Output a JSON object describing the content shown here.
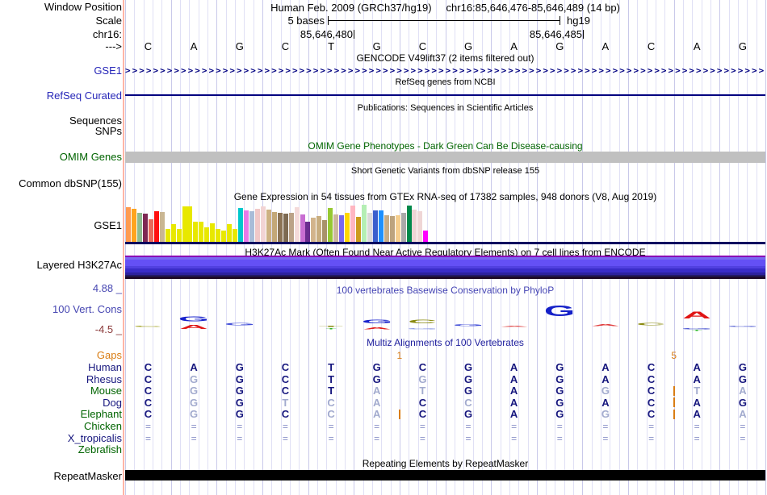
{
  "header": {
    "assembly": "Human Feb. 2009 (GRCh37/hg19)",
    "position": "chr16:85,646,476-85,646,489 (14 bp)"
  },
  "scale": {
    "value": "5 bases",
    "genome": "hg19"
  },
  "coords": {
    "left": "85,646,480",
    "right": "85,646,485"
  },
  "ruler_bases": [
    "C",
    "A",
    "G",
    "C",
    "T",
    "G",
    "C",
    "G",
    "A",
    "G",
    "A",
    "C",
    "A",
    "G"
  ],
  "labels": {
    "window_position": "Window Position",
    "scale": "Scale",
    "chrom": "chr16:",
    "direction": "--->",
    "gse1_gencode": "GSE1",
    "refseq_curated": "RefSeq Curated",
    "sequences": "Sequences",
    "snps": "SNPs",
    "omim_genes": "OMIM Genes",
    "common_dbsnp": "Common dbSNP(155)",
    "gse1_gtex": "GSE1",
    "layered_h3k27ac": "Layered H3K27Ac",
    "cons_max": "4.88 _",
    "vert_cons": "100 Vert. Cons",
    "cons_min": "-4.5 _",
    "gaps": "Gaps",
    "repeatmasker": "RepeatMasker"
  },
  "titles": {
    "gencode": "GENCODE V49lift37 (2 items filtered out)",
    "refseq": "RefSeq genes from NCBI",
    "publications": "Publications: Sequences in Scientific Articles",
    "omim": "OMIM Gene Phenotypes - Dark Green Can Be Disease-causing",
    "dbsnp": "Short Genetic Variants from dbSNP release 155",
    "gtex": "Gene Expression in 54 tissues from GTEx RNA-seq of 17382 samples, 948 donors (V8, Aug 2019)",
    "h3k27ac": "H3K27Ac Mark (Often Found Near Active Regulatory Elements) on 7 cell lines from ENCODE",
    "phylop": "100 vertebrates Basewise Conservation by PhyloP",
    "multiz": "Multiz Alignments of 100 Vertebrates",
    "repeatmasker": "Repeating Elements by RepeatMasker"
  },
  "colors": {
    "label_blue": "#2626b8",
    "dark_green": "#006400",
    "orange": "#d97d14",
    "navy_letter": "#16167e",
    "light_letter": "#a2aace",
    "eq_letter": "#8890c8",
    "grid_light": "#e0e0f5",
    "grid_dark": "#c9c9ea",
    "pink_edge": "#ffb4a6",
    "track_navy": "#000080",
    "baseline_navy": "#000060",
    "omim_gray": "#c0c0c0",
    "repeat_black": "#000000",
    "phylop_title": "#4646b4",
    "multiz_title": "#20209e",
    "cons_label": "#4747b2",
    "cons_min_red": "#8b3a3a"
  },
  "gtex_track": {
    "type": "bar",
    "note": "54 tissue expression bars, heights in px below 45px max, baseline navy",
    "bars": [
      [
        "#FF9A50",
        43
      ],
      [
        "#FFA41E",
        41
      ],
      [
        "#8FBC8F",
        36
      ],
      [
        "#7E2954",
        35
      ],
      [
        "#E8695A",
        28
      ],
      [
        "#FF1010",
        38
      ],
      [
        "#C9B693",
        37
      ],
      [
        "#E8E800",
        16
      ],
      [
        "#E8E800",
        22
      ],
      [
        "#E8E800",
        16
      ],
      [
        "#E8E800",
        44
      ],
      [
        "#E8E800",
        44
      ],
      [
        "#E8E800",
        25
      ],
      [
        "#E8E800",
        25
      ],
      [
        "#E8E800",
        18
      ],
      [
        "#E8E800",
        23
      ],
      [
        "#E8E800",
        16
      ],
      [
        "#E8E800",
        14
      ],
      [
        "#E8E800",
        22
      ],
      [
        "#E8E800",
        16
      ],
      [
        "#00C8CC",
        42
      ],
      [
        "#E87AE8",
        39
      ],
      [
        "#A8BCD8",
        38
      ],
      [
        "#F0C8C8",
        41
      ],
      [
        "#F2D4D4",
        44
      ],
      [
        "#CDB183",
        40
      ],
      [
        "#C4A878",
        37
      ],
      [
        "#8B7355",
        36
      ],
      [
        "#7D6A52",
        35
      ],
      [
        "#BBA288",
        36
      ],
      [
        "#F4DADA",
        43
      ],
      [
        "#C86ED2",
        34
      ],
      [
        "#6A2D8F",
        25
      ],
      [
        "#D2B48C",
        30
      ],
      [
        "#C8AD7F",
        32
      ],
      [
        "#A9926B",
        27
      ],
      [
        "#96C832",
        42
      ],
      [
        "#CDB79E",
        34
      ],
      [
        "#7A67EE",
        33
      ],
      [
        "#FFD700",
        36
      ],
      [
        "#FFB6C1",
        45
      ],
      [
        "#CD9B1D",
        31
      ],
      [
        "#B4EEB4",
        46
      ],
      [
        "#D9D9D9",
        36
      ],
      [
        "#3A5FCD",
        39
      ],
      [
        "#1E90FF",
        39
      ],
      [
        "#C8AD87",
        33
      ],
      [
        "#BCA37E",
        32
      ],
      [
        "#F5CE8E",
        33
      ],
      [
        "#A9A9A9",
        36
      ],
      [
        "#00894B",
        45
      ],
      [
        "#EED5D5",
        40
      ],
      [
        "#EFD6D6",
        38
      ],
      [
        "#FF00FF",
        14
      ]
    ]
  },
  "h3k27ac_bands": [
    [
      "#8A00B4",
      2
    ],
    [
      "#7B68F0",
      3
    ],
    [
      "#6450F5",
      8
    ],
    [
      "#5140E0",
      3
    ],
    [
      "#3A2CC8",
      5
    ],
    [
      "#2D21A0",
      3
    ],
    [
      "#231A66",
      2
    ],
    [
      "#1E0A28",
      3
    ]
  ],
  "conservation": {
    "positions": [
      {
        "up": [
          [
            "C",
            "#96960a",
            2
          ]
        ],
        "down": []
      },
      {
        "up": [
          [
            "G",
            "#1822cc",
            8
          ]
        ],
        "down": [
          [
            "A",
            "#e01818",
            7
          ]
        ]
      },
      {
        "up": [
          [
            "G",
            "#4450d8",
            4
          ]
        ],
        "down": []
      },
      {
        "up": [],
        "down": []
      },
      {
        "up": [
          [
            "T",
            "#8a8a10",
            2
          ]
        ],
        "down": [
          [
            "T",
            "#28b428",
            2,
            1
          ]
        ]
      },
      {
        "up": [
          [
            "G",
            "#1822cc",
            6
          ]
        ],
        "down": [
          [
            "A",
            "#e02020",
            3
          ]
        ]
      },
      {
        "up": [
          [
            "C",
            "#8a8a10",
            6
          ]
        ],
        "down": [
          [
            "G",
            "#8090e0",
            2
          ]
        ]
      },
      {
        "up": [
          [
            "G",
            "#4450d8",
            3
          ]
        ],
        "down": []
      },
      {
        "up": [
          [
            "A",
            "#e05050",
            2
          ]
        ],
        "down": []
      },
      {
        "up": [
          [
            "G",
            "#1420c8",
            17
          ]
        ],
        "down": []
      },
      {
        "up": [
          [
            "A",
            "#e04040",
            3
          ]
        ],
        "down": []
      },
      {
        "up": [
          [
            "C",
            "#8a8a10",
            4
          ]
        ],
        "down": []
      },
      {
        "up": [
          [
            "A",
            "#e01414",
            11
          ]
        ],
        "down": [
          [
            "G",
            "#2a36c8",
            2
          ],
          [
            "T",
            "#28b428",
            2,
            1
          ]
        ]
      },
      {
        "up": [
          [
            "G",
            "#4a56d0",
            2
          ]
        ],
        "down": []
      }
    ]
  },
  "multiz": {
    "gap_markers": [
      {
        "label": "1",
        "boundary": 6
      },
      {
        "label": "5",
        "boundary": 12
      }
    ],
    "insertions": [
      {
        "boundary": 6,
        "rows": [
          4
        ]
      },
      {
        "boundary": 12,
        "rows": [
          2,
          3,
          4
        ]
      }
    ],
    "rows": [
      {
        "label": "Human",
        "label_color": "#16167e",
        "seq": "CAGCTGCGAGACAG",
        "light": []
      },
      {
        "label": "Rhesus",
        "label_color": "#16167e",
        "seq": "CGGCTGGGAGACAG",
        "light": [
          2,
          7
        ]
      },
      {
        "label": "Mouse",
        "label_color": "#006400",
        "seq": "CGGCTATGAGGCTA",
        "light": [
          2,
          6,
          7,
          11,
          13,
          14
        ]
      },
      {
        "label": "Dog",
        "label_color": "#16167e",
        "seq": "CGGTCACCAGACAG",
        "light": [
          2,
          4,
          5,
          6,
          8
        ]
      },
      {
        "label": "Elephant",
        "label_color": "#006400",
        "seq": "CGGCCACGAGGCAA",
        "light": [
          2,
          5,
          6,
          11,
          14
        ]
      },
      {
        "label": "Chicken",
        "label_color": "#006400",
        "seq": "==============",
        "eq": true
      },
      {
        "label": "X_tropicalis",
        "label_color": "#16167e",
        "seq": "==============",
        "eq": true
      },
      {
        "label": "Zebrafish",
        "label_color": "#006400",
        "seq": "",
        "eq": false
      }
    ]
  }
}
